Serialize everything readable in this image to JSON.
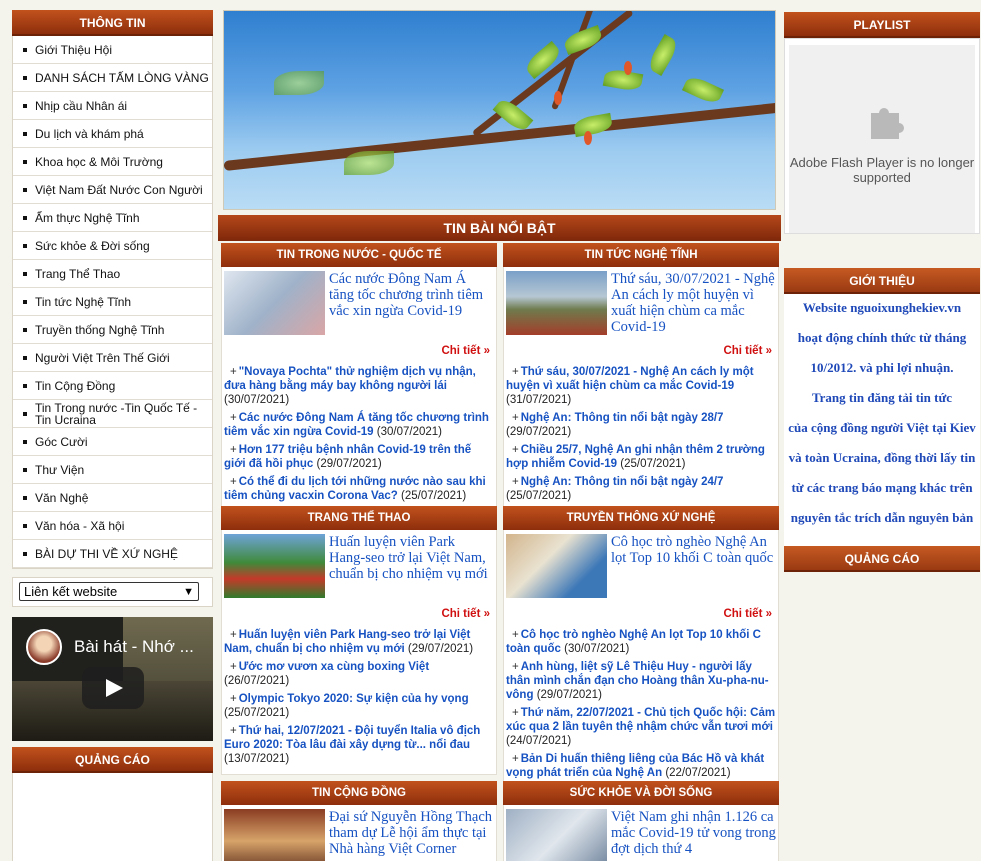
{
  "left": {
    "menu_title": "THÔNG TIN",
    "items": [
      "Giới Thiệu Hội",
      "DANH SÁCH TẤM LÒNG VÀNG",
      "Nhịp cầu Nhân ái",
      "Du lịch và khám phá",
      "Khoa học & Môi Trường",
      "Việt Nam Đất Nước Con Người",
      "Ẩm thực Nghệ Tĩnh",
      "Sức khỏe & Đời sống",
      "Trang Thể Thao",
      "Tin tức Nghệ Tĩnh",
      "Truyền thống Nghệ Tĩnh",
      "Người Việt Trên Thế Giới",
      "Tin Cộng Đồng",
      "Tin Trong nước -Tin Quốc Tế - Tin Ucraina",
      "Góc Cười",
      "Thư Viện",
      "Văn Nghệ",
      "Văn hóa - Xã hội",
      "BÀI DỰ THI VỀ XỨ NGHỆ"
    ],
    "links_select": "Liên kết website",
    "video_title": "Bài hát - Nhớ ...",
    "ads_title": "QUẢNG CÁO"
  },
  "center": {
    "hot_title": "TIN BÀI NỔI BẬT",
    "more_label": "Chi tiết »",
    "sections": [
      {
        "title": "TIN TRONG NƯỚC - QUỐC TẾ",
        "feature": "Các nước Đông Nam Á tăng tốc chương trình tiêm vắc xin ngừa Covid-19",
        "items": [
          {
            "text": "\"Novaya Pochta\" thử nghiệm dịch vụ nhận, đưa hàng bằng máy bay không người lái",
            "date": "(30/07/2021)"
          },
          {
            "text": "Các nước Đông Nam Á tăng tốc chương trình tiêm vắc xin ngừa Covid-19",
            "date": "(30/07/2021)"
          },
          {
            "text": "Hơn 177 triệu bệnh nhân Covid-19 trên thế giới đã hồi phục",
            "date": "(29/07/2021)"
          },
          {
            "text": "Có thể đi du lịch tới những nước nào sau khi tiêm chủng vacxin Corona Vac?",
            "date": "(25/07/2021)"
          }
        ]
      },
      {
        "title": "TIN TỨC NGHỆ TĨNH",
        "feature": "Thứ sáu, 30/07/2021 - Nghệ An cách ly một huyện vì xuất hiện chùm ca mắc Covid-19",
        "items": [
          {
            "text": "Thứ sáu, 30/07/2021 - Nghệ An cách ly một huyện vì xuất hiện chùm ca mắc Covid-19",
            "date": "(31/07/2021)"
          },
          {
            "text": "Nghệ An: Thông tin nổi bật ngày 28/7",
            "date": "(29/07/2021)"
          },
          {
            "text": "Chiều 25/7, Nghệ An ghi nhận thêm 2 trường hợp nhiễm Covid-19",
            "date": "(25/07/2021)"
          },
          {
            "text": "Nghệ An: Thông tin nổi bật ngày 24/7",
            "date": "(25/07/2021)"
          }
        ]
      },
      {
        "title": "TRANG THỂ THAO",
        "feature": "Huấn luyện viên Park Hang-seo trở lại Việt Nam, chuẩn bị cho nhiệm vụ mới",
        "items": [
          {
            "text": "Huấn luyện viên Park Hang-seo trở lại Việt Nam, chuẩn bị cho nhiệm vụ mới",
            "date": "(29/07/2021)"
          },
          {
            "text": "Ước mơ vươn xa cùng boxing Việt",
            "date": "(26/07/2021)"
          },
          {
            "text": "Olympic Tokyo 2020: Sự kiện của hy vọng",
            "date": "(25/07/2021)"
          },
          {
            "text": "Thứ hai, 12/07/2021 - Đội tuyển Italia vô địch Euro 2020: Tòa lâu đài xây dựng từ... nổi đau",
            "date": "(13/07/2021)"
          }
        ]
      },
      {
        "title": "TRUYỀN THÔNG XỨ NGHỆ",
        "feature": "Cô học trò nghèo Nghệ An lọt Top 10 khối C toàn quốc",
        "items": [
          {
            "text": "Cô học trò nghèo Nghệ An lọt Top 10 khối C toàn quốc",
            "date": "(30/07/2021)"
          },
          {
            "text": "Anh hùng, liệt sỹ Lê Thiệu Huy - người lấy thân mình chắn đạn cho Hoàng thân Xu-pha-nu-vông",
            "date": "(29/07/2021)"
          },
          {
            "text": "Thứ năm, 22/07/2021 - Chủ tịch Quốc hội: Cảm xúc qua 2 lần tuyên thệ nhậm chức vẫn tươi mới",
            "date": "(24/07/2021)"
          },
          {
            "text": "Bản Di huấn thiêng liêng của Bác Hồ và khát vọng phát triển của Nghệ An",
            "date": "(22/07/2021)"
          }
        ]
      },
      {
        "title": "TIN CỘNG ĐỒNG",
        "feature": "Đại sứ Nguyễn Hồng Thạch tham dự Lễ hội ẩm thực tại Nhà hàng Việt Corner"
      },
      {
        "title": "SỨC KHỎE VÀ ĐỜI SỐNG",
        "feature": "Việt Nam ghi nhận 1.126 ca mắc Covid-19 tử vong trong đợt dịch thứ 4"
      }
    ]
  },
  "right": {
    "playlist_title": "PLAYLIST",
    "flash_message": "Adobe Flash Player is no longer supported",
    "intro_title": "GIỚI THIỆU",
    "intro_lines": [
      "Website nguoixunghekiev.vn",
      "hoạt động chính thức từ tháng",
      "10/2012. và  phi lợi nhuận.",
      "Trang tin đăng tải tin tức",
      "của cộng đồng người Việt tại Kiev",
      "và toàn Ucraina, đồng thời lấy tin",
      "từ các trang báo mạng khác trên",
      "nguyên tắc trích dẫn nguyên bản"
    ],
    "ads_title": "QUẢNG CÁO"
  }
}
